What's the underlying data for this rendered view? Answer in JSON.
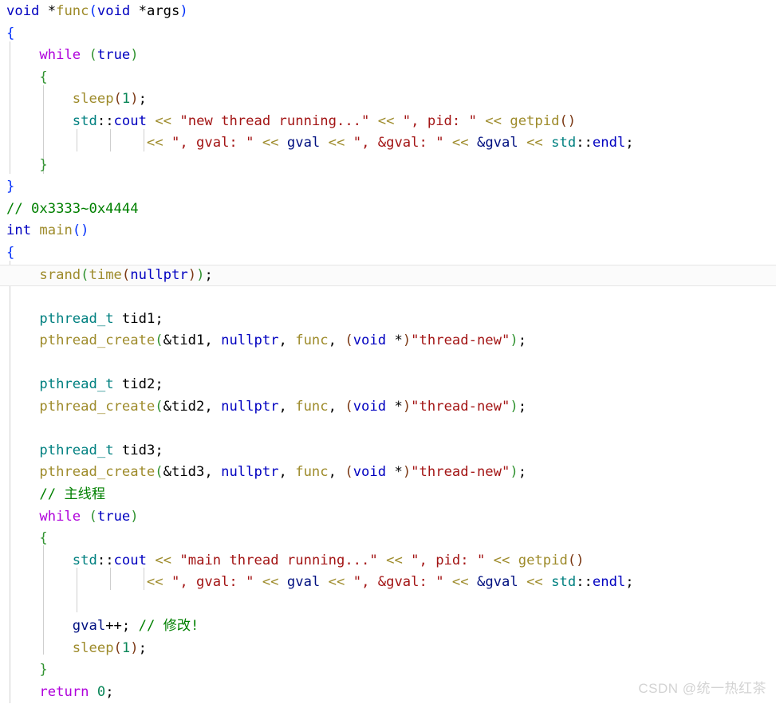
{
  "editor": {
    "language": "C++",
    "background": "#ffffff",
    "font_size_px": 17,
    "line_height_px": 27.55,
    "highlighted_line_index": 14,
    "colors": {
      "keyword": "#0000c0",
      "control_keyword": "#af00db",
      "type": "#008080",
      "function": "#9e8b2b",
      "string": "#a31515",
      "comment": "#008000",
      "number": "#098658",
      "variable": "#001080",
      "bracket_level_1": "#0431fa",
      "bracket_level_2": "#319331",
      "bracket_level_3": "#7b3814",
      "indent_guide": "#cfcfcf",
      "current_line_bg": "#fbfbfb",
      "watermark": "#d3d3d3"
    },
    "lines": [
      {
        "index": 0,
        "text": "void *func(void *args)"
      },
      {
        "index": 1,
        "text": "{"
      },
      {
        "index": 2,
        "text": "    while (true)"
      },
      {
        "index": 3,
        "text": "    {"
      },
      {
        "index": 4,
        "text": "        sleep(1);"
      },
      {
        "index": 5,
        "text": "        std::cout << \"new thread running...\" << \", pid: \" << getpid()"
      },
      {
        "index": 6,
        "text": "                 << \", gval: \" << gval << \", &gval: \" << &gval << std::endl;"
      },
      {
        "index": 7,
        "text": "    }"
      },
      {
        "index": 8,
        "text": "}"
      },
      {
        "index": 9,
        "text": "// 0x3333~0x4444"
      },
      {
        "index": 10,
        "text": "int main()"
      },
      {
        "index": 11,
        "text": "{"
      },
      {
        "index": 12,
        "text": "    srand(time(nullptr));"
      },
      {
        "index": 13,
        "text": ""
      },
      {
        "index": 14,
        "text": "    pthread_t tid1;"
      },
      {
        "index": 15,
        "text": "    pthread_create(&tid1, nullptr, func, (void *)\"thread-new\");"
      },
      {
        "index": 16,
        "text": ""
      },
      {
        "index": 17,
        "text": "    pthread_t tid2;"
      },
      {
        "index": 18,
        "text": "    pthread_create(&tid2, nullptr, func, (void *)\"thread-new\");"
      },
      {
        "index": 19,
        "text": ""
      },
      {
        "index": 20,
        "text": "    pthread_t tid3;"
      },
      {
        "index": 21,
        "text": "    pthread_create(&tid3, nullptr, func, (void *)\"thread-new\");"
      },
      {
        "index": 22,
        "text": "    // 主线程"
      },
      {
        "index": 23,
        "text": "    while (true)"
      },
      {
        "index": 24,
        "text": "    {"
      },
      {
        "index": 25,
        "text": "        std::cout << \"main thread running...\" << \", pid: \" << getpid()"
      },
      {
        "index": 26,
        "text": "                 << \", gval: \" << gval << \", &gval: \" << &gval << std::endl;"
      },
      {
        "index": 27,
        "text": ""
      },
      {
        "index": 28,
        "text": "        gval++; // 修改!"
      },
      {
        "index": 29,
        "text": "        sleep(1);"
      },
      {
        "index": 30,
        "text": "    }"
      },
      {
        "index": 31,
        "text": "    return 0;"
      }
    ],
    "tokens": {
      "l0": {
        "t1": "void",
        "t2": " *",
        "t3": "func",
        "t4": "(",
        "t5": "void",
        "t6": " *",
        "t7": "args",
        "t8": ")"
      },
      "l1": {
        "t1": "{"
      },
      "l2": {
        "indent": "    ",
        "t1": "while",
        "t2": " ",
        "t3": "(",
        "t4": "true",
        "t5": ")"
      },
      "l3": {
        "indent": "    ",
        "t1": "{"
      },
      "l4": {
        "indent": "        ",
        "t1": "sleep",
        "t2": "(",
        "t3": "1",
        "t4": ")",
        "t5": ";"
      },
      "l5": {
        "indent": "        ",
        "t1": "std",
        "t2": "::",
        "t3": "cout",
        "t4": " ",
        "t5": "<<",
        "t6": " ",
        "t7": "\"new thread running...\"",
        "t8": " ",
        "t9": "<<",
        "t10": " ",
        "t11": "\", pid: \"",
        "t12": " ",
        "t13": "<<",
        "t14": " ",
        "t15": "getpid",
        "t16": "()"
      },
      "l6": {
        "indent": "                 ",
        "t1": "<<",
        "t2": " ",
        "t3": "\", gval: \"",
        "t4": " ",
        "t5": "<<",
        "t6": " ",
        "t7": "gval",
        "t8": " ",
        "t9": "<<",
        "t10": " ",
        "t11": "\", &gval: \"",
        "t12": " ",
        "t13": "<<",
        "t14": " ",
        "t15": "&gval",
        "t16": " ",
        "t17": "<<",
        "t18": " ",
        "t19": "std",
        "t20": "::",
        "t21": "endl",
        "t22": ";"
      },
      "l7": {
        "indent": "    ",
        "t1": "}"
      },
      "l8": {
        "t1": "}"
      },
      "l9": {
        "t1": "// 0x3333~0x4444"
      },
      "l10": {
        "t1": "int",
        "t2": " ",
        "t3": "main",
        "t4": "()"
      },
      "l11": {
        "t1": "{"
      },
      "l12": {
        "indent": "    ",
        "t1": "srand",
        "t2": "(",
        "t3": "time",
        "t4": "(",
        "t5": "nullptr",
        "t6": ")",
        "t7": ")",
        "t8": ";"
      },
      "l14": {
        "indent": "    ",
        "t1": "pthread_t",
        "t2": " ",
        "t3": "tid1",
        "t4": ";"
      },
      "l15": {
        "indent": "    ",
        "t1": "pthread_create",
        "t2": "(",
        "t3": "&tid1",
        "t4": ", ",
        "t5": "nullptr",
        "t6": ", ",
        "t7": "func",
        "t8": ", ",
        "t9": "(",
        "t10": "void",
        "t11": " *",
        "t12": ")",
        "t13": "\"thread-new\"",
        "t14": ")",
        "t15": ";"
      },
      "l17": {
        "indent": "    ",
        "t1": "pthread_t",
        "t2": " ",
        "t3": "tid2",
        "t4": ";"
      },
      "l18": {
        "indent": "    ",
        "t1": "pthread_create",
        "t2": "(",
        "t3": "&tid2",
        "t4": ", ",
        "t5": "nullptr",
        "t6": ", ",
        "t7": "func",
        "t8": ", ",
        "t9": "(",
        "t10": "void",
        "t11": " *",
        "t12": ")",
        "t13": "\"thread-new\"",
        "t14": ")",
        "t15": ";"
      },
      "l20": {
        "indent": "    ",
        "t1": "pthread_t",
        "t2": " ",
        "t3": "tid3",
        "t4": ";"
      },
      "l21": {
        "indent": "    ",
        "t1": "pthread_create",
        "t2": "(",
        "t3": "&tid3",
        "t4": ", ",
        "t5": "nullptr",
        "t6": ", ",
        "t7": "func",
        "t8": ", ",
        "t9": "(",
        "t10": "void",
        "t11": " *",
        "t12": ")",
        "t13": "\"thread-new\"",
        "t14": ")",
        "t15": ";"
      },
      "l22": {
        "indent": "    ",
        "t1": "// 主线程"
      },
      "l23": {
        "indent": "    ",
        "t1": "while",
        "t2": " ",
        "t3": "(",
        "t4": "true",
        "t5": ")"
      },
      "l24": {
        "indent": "    ",
        "t1": "{"
      },
      "l25": {
        "indent": "        ",
        "t1": "std",
        "t2": "::",
        "t3": "cout",
        "t4": " ",
        "t5": "<<",
        "t6": " ",
        "t7": "\"main thread running...\"",
        "t8": " ",
        "t9": "<<",
        "t10": " ",
        "t11": "\", pid: \"",
        "t12": " ",
        "t13": "<<",
        "t14": " ",
        "t15": "getpid",
        "t16": "()"
      },
      "l26": {
        "indent": "                 ",
        "t1": "<<",
        "t2": " ",
        "t3": "\", gval: \"",
        "t4": " ",
        "t5": "<<",
        "t6": " ",
        "t7": "gval",
        "t8": " ",
        "t9": "<<",
        "t10": " ",
        "t11": "\", &gval: \"",
        "t12": " ",
        "t13": "<<",
        "t14": " ",
        "t15": "&gval",
        "t16": " ",
        "t17": "<<",
        "t18": " ",
        "t19": "std",
        "t20": "::",
        "t21": "endl",
        "t22": ";"
      },
      "l28": {
        "indent": "        ",
        "t1": "gval",
        "t2": "++",
        "t3": "; ",
        "t4": "// 修改!"
      },
      "l29": {
        "indent": "        ",
        "t1": "sleep",
        "t2": "(",
        "t3": "1",
        "t4": ")",
        "t5": ";"
      },
      "l30": {
        "indent": "    ",
        "t1": "}"
      },
      "l31": {
        "indent": "    ",
        "t1": "return",
        "t2": " ",
        "t3": "0",
        "t4": ";"
      }
    }
  },
  "watermark": {
    "text": "CSDN @统一热红茶"
  }
}
